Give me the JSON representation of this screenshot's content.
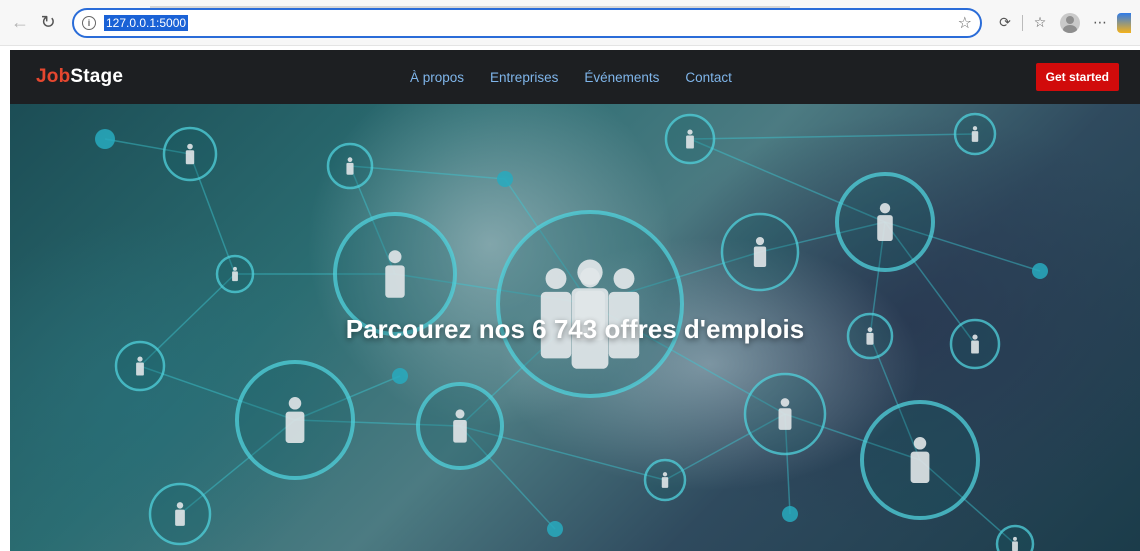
{
  "browser": {
    "url": "127.0.0.1:5000"
  },
  "navbar": {
    "brand_accent": "Job",
    "brand_rest": "Stage",
    "links": [
      "À propos",
      "Entreprises",
      "Événements",
      "Contact"
    ],
    "cta_label": "Get started"
  },
  "hero": {
    "title_prefix": "Parcourez nos ",
    "job_count": "6 743",
    "title_suffix": " offres d'emplois"
  },
  "colors": {
    "brand_accent": "#e5472f",
    "nav_link": "#7fb5ea",
    "cta": "#d10b0b",
    "navbar_bg": "#1d1f22"
  }
}
